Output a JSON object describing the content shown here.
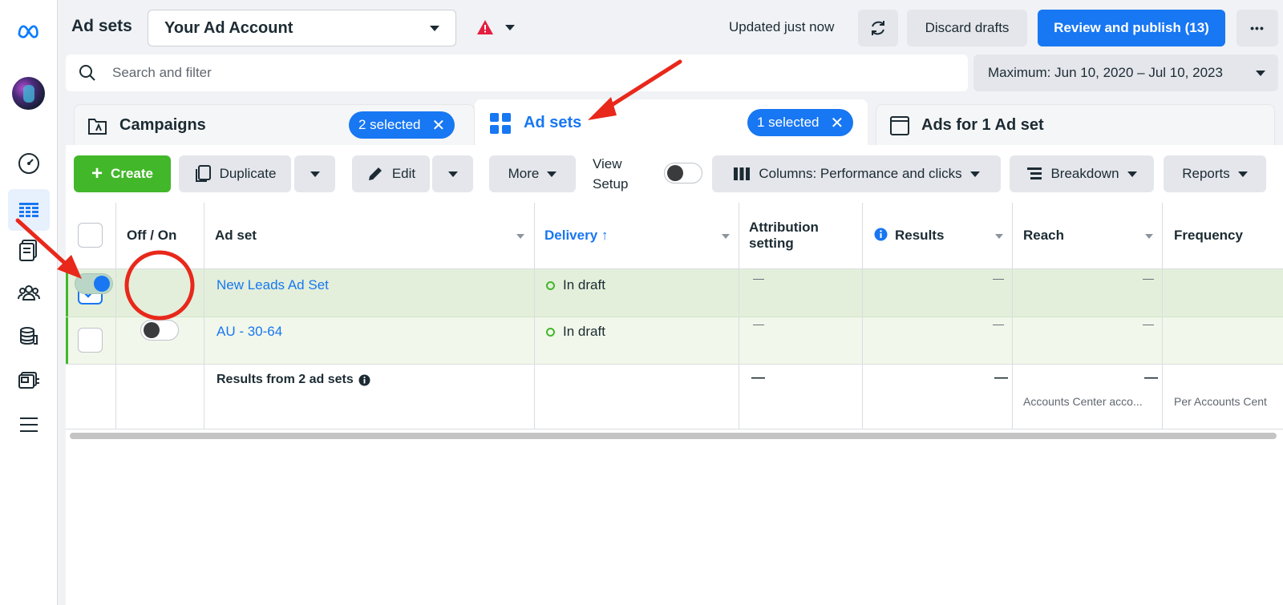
{
  "header": {
    "title": "Ad sets",
    "account_name": "Your Ad Account",
    "updated_text": "Updated just now",
    "discard_label": "Discard drafts",
    "publish_label": "Review and publish (13)",
    "more_label": "•••"
  },
  "search": {
    "placeholder": "Search and filter",
    "date_range": "Maximum: Jun 10, 2020 – Jul 10, 2023"
  },
  "tabs": [
    {
      "label": "Campaigns",
      "chip": "2 selected"
    },
    {
      "label": "Ad sets",
      "chip": "1 selected"
    },
    {
      "label": "Ads for 1 Ad set"
    }
  ],
  "toolbar": {
    "create": "Create",
    "duplicate": "Duplicate",
    "edit": "Edit",
    "more": "More",
    "view_setup": "View Setup",
    "columns": "Columns: Performance and clicks",
    "breakdown": "Breakdown",
    "reports": "Reports"
  },
  "table": {
    "headers": {
      "off_on": "Off / On",
      "ad_set": "Ad set",
      "delivery": "Delivery ↑",
      "attribution": "Attribution setting",
      "results": "Results",
      "reach": "Reach",
      "frequency": "Frequency"
    },
    "rows": [
      {
        "name": "New Leads Ad Set",
        "delivery": "In draft",
        "checked": true,
        "on": true,
        "attribution": "—",
        "results": "—",
        "reach": "—"
      },
      {
        "name": "AU - 30-64",
        "delivery": "In draft",
        "checked": false,
        "on": false,
        "attribution": "—",
        "results": "—",
        "reach": "—"
      }
    ],
    "summary": {
      "label": "Results from 2 ad sets",
      "attribution": "—",
      "results": "—",
      "reach": "—",
      "reach_note": "Accounts Center acco...",
      "frequency_note": "Per Accounts Cent"
    }
  },
  "colors": {
    "accent": "#1877f2",
    "create_green": "#42b72a",
    "row_selected": "#e3efda",
    "row_alt": "#f1f7ea",
    "annotation_red": "#e8281b"
  }
}
